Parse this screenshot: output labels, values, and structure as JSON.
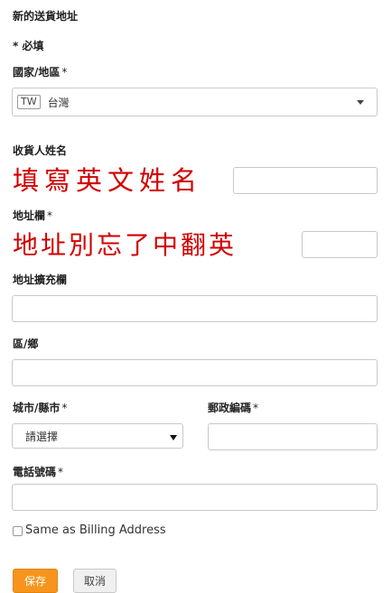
{
  "form": {
    "title": "新的送貨地址",
    "required_note": "* 必填",
    "country": {
      "label": "國家/地區",
      "required_mark": "*",
      "code": "TW",
      "value": "台灣"
    },
    "recipient_name": {
      "label": "收貨人姓名",
      "value": ""
    },
    "address": {
      "label": "地址欄",
      "required_mark": "*",
      "value": ""
    },
    "address2": {
      "label": "地址擴充欄",
      "value": ""
    },
    "district": {
      "label": "區/鄉",
      "value": ""
    },
    "city": {
      "label": "城市/縣市",
      "required_mark": "*",
      "selected": "請選擇"
    },
    "postal_code": {
      "label": "郵政編碼",
      "required_mark": "*",
      "value": ""
    },
    "phone": {
      "label": "電話號碼",
      "required_mark": "*",
      "value": ""
    },
    "same_as_billing": {
      "label": "Same as Billing Address",
      "checked": false
    },
    "buttons": {
      "save": "保存",
      "cancel": "取消"
    }
  },
  "annotations": {
    "note_name": "填寫英文姓名",
    "note_address": "地址別忘了中翻英"
  },
  "colors": {
    "accent": "#f7941d",
    "annotation": "#d10000",
    "border": "#c8c8c8"
  }
}
